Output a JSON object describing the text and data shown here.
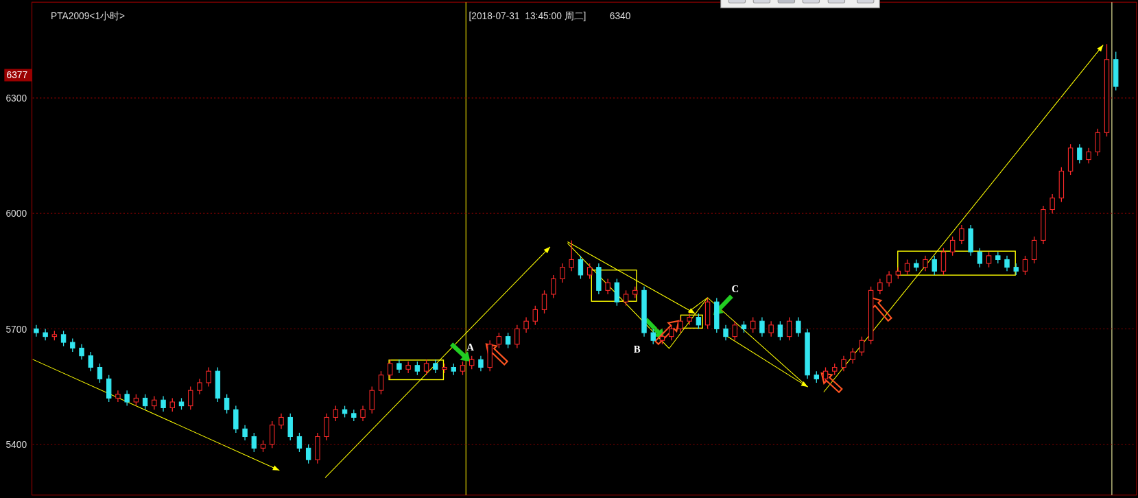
{
  "chart": {
    "title": "PTA2009<1小时>",
    "cursor_time": "[2018-07-31  13:45:00 周二]",
    "cursor_price": "6340",
    "price_tag": "6377",
    "markers": [
      {
        "label": "A"
      },
      {
        "label": "B"
      },
      {
        "label": "C"
      }
    ],
    "chart_data": {
      "type": "candlestick",
      "grid": true,
      "ylim": [
        5268,
        6549
      ],
      "yticks": [
        6300,
        6000,
        5700,
        5400
      ],
      "ohlc": [
        [
          5700,
          5710,
          5680,
          5690
        ],
        [
          5690,
          5700,
          5670,
          5680
        ],
        [
          5680,
          5695,
          5670,
          5685
        ],
        [
          5685,
          5695,
          5655,
          5665
        ],
        [
          5665,
          5675,
          5640,
          5650
        ],
        [
          5650,
          5660,
          5620,
          5630
        ],
        [
          5630,
          5640,
          5590,
          5600
        ],
        [
          5600,
          5610,
          5560,
          5570
        ],
        [
          5570,
          5580,
          5510,
          5520
        ],
        [
          5520,
          5540,
          5510,
          5530
        ],
        [
          5530,
          5540,
          5500,
          5510
        ],
        [
          5510,
          5530,
          5500,
          5520
        ],
        [
          5520,
          5530,
          5490,
          5500
        ],
        [
          5500,
          5525,
          5490,
          5515
        ],
        [
          5515,
          5525,
          5485,
          5495
        ],
        [
          5495,
          5520,
          5485,
          5510
        ],
        [
          5510,
          5520,
          5490,
          5500
        ],
        [
          5500,
          5550,
          5490,
          5540
        ],
        [
          5540,
          5570,
          5530,
          5560
        ],
        [
          5560,
          5600,
          5550,
          5590
        ],
        [
          5590,
          5600,
          5510,
          5520
        ],
        [
          5520,
          5530,
          5480,
          5490
        ],
        [
          5490,
          5500,
          5430,
          5440
        ],
        [
          5440,
          5450,
          5410,
          5420
        ],
        [
          5420,
          5430,
          5380,
          5390
        ],
        [
          5390,
          5410,
          5380,
          5400
        ],
        [
          5400,
          5460,
          5390,
          5450
        ],
        [
          5450,
          5480,
          5440,
          5470
        ],
        [
          5470,
          5480,
          5410,
          5420
        ],
        [
          5420,
          5430,
          5380,
          5390
        ],
        [
          5390,
          5400,
          5350,
          5360
        ],
        [
          5360,
          5430,
          5350,
          5420
        ],
        [
          5420,
          5480,
          5410,
          5470
        ],
        [
          5470,
          5500,
          5460,
          5490
        ],
        [
          5490,
          5500,
          5470,
          5480
        ],
        [
          5480,
          5490,
          5460,
          5470
        ],
        [
          5470,
          5500,
          5460,
          5490
        ],
        [
          5490,
          5550,
          5480,
          5540
        ],
        [
          5540,
          5590,
          5530,
          5580
        ],
        [
          5580,
          5620,
          5570,
          5610
        ],
        [
          5610,
          5620,
          5585,
          5595
        ],
        [
          5595,
          5615,
          5585,
          5605
        ],
        [
          5605,
          5615,
          5580,
          5590
        ],
        [
          5590,
          5620,
          5580,
          5610
        ],
        [
          5610,
          5620,
          5585,
          5595
        ],
        [
          5595,
          5610,
          5585,
          5600
        ],
        [
          5600,
          5610,
          5580,
          5590
        ],
        [
          5590,
          5615,
          5580,
          5605
        ],
        [
          5605,
          5630,
          5595,
          5620
        ],
        [
          5620,
          5630,
          5590,
          5600
        ],
        [
          5600,
          5670,
          5590,
          5660
        ],
        [
          5660,
          5690,
          5650,
          5680
        ],
        [
          5680,
          5690,
          5650,
          5660
        ],
        [
          5660,
          5710,
          5650,
          5700
        ],
        [
          5700,
          5730,
          5690,
          5720
        ],
        [
          5720,
          5760,
          5710,
          5750
        ],
        [
          5750,
          5800,
          5740,
          5790
        ],
        [
          5790,
          5840,
          5780,
          5830
        ],
        [
          5830,
          5870,
          5820,
          5860
        ],
        [
          5860,
          5930,
          5850,
          5880
        ],
        [
          5880,
          5890,
          5830,
          5840
        ],
        [
          5840,
          5870,
          5830,
          5860
        ],
        [
          5860,
          5870,
          5790,
          5800
        ],
        [
          5800,
          5830,
          5790,
          5820
        ],
        [
          5820,
          5830,
          5760,
          5770
        ],
        [
          5770,
          5800,
          5760,
          5790
        ],
        [
          5790,
          5810,
          5780,
          5800
        ],
        [
          5800,
          5810,
          5680,
          5690
        ],
        [
          5690,
          5700,
          5660,
          5670
        ],
        [
          5670,
          5690,
          5660,
          5680
        ],
        [
          5680,
          5710,
          5670,
          5700
        ],
        [
          5700,
          5730,
          5690,
          5720
        ],
        [
          5720,
          5740,
          5710,
          5730
        ],
        [
          5730,
          5740,
          5700,
          5710
        ],
        [
          5710,
          5780,
          5700,
          5770
        ],
        [
          5770,
          5780,
          5690,
          5700
        ],
        [
          5700,
          5710,
          5670,
          5680
        ],
        [
          5680,
          5720,
          5670,
          5710
        ],
        [
          5710,
          5720,
          5690,
          5700
        ],
        [
          5700,
          5730,
          5690,
          5720
        ],
        [
          5720,
          5730,
          5680,
          5690
        ],
        [
          5690,
          5720,
          5680,
          5710
        ],
        [
          5710,
          5720,
          5670,
          5680
        ],
        [
          5680,
          5730,
          5670,
          5720
        ],
        [
          5720,
          5730,
          5680,
          5690
        ],
        [
          5690,
          5700,
          5570,
          5580
        ],
        [
          5580,
          5590,
          5560,
          5570
        ],
        [
          5570,
          5600,
          5560,
          5590
        ],
        [
          5590,
          5610,
          5580,
          5600
        ],
        [
          5600,
          5630,
          5590,
          5620
        ],
        [
          5620,
          5650,
          5610,
          5640
        ],
        [
          5640,
          5680,
          5630,
          5670
        ],
        [
          5670,
          5810,
          5660,
          5800
        ],
        [
          5800,
          5830,
          5790,
          5820
        ],
        [
          5820,
          5850,
          5810,
          5840
        ],
        [
          5840,
          5860,
          5830,
          5850
        ],
        [
          5850,
          5880,
          5840,
          5870
        ],
        [
          5870,
          5880,
          5850,
          5860
        ],
        [
          5860,
          5890,
          5850,
          5880
        ],
        [
          5880,
          5890,
          5840,
          5850
        ],
        [
          5850,
          5910,
          5840,
          5900
        ],
        [
          5900,
          5940,
          5890,
          5930
        ],
        [
          5930,
          5970,
          5920,
          5960
        ],
        [
          5960,
          5970,
          5890,
          5900
        ],
        [
          5900,
          5910,
          5860,
          5870
        ],
        [
          5870,
          5900,
          5860,
          5890
        ],
        [
          5890,
          5900,
          5870,
          5880
        ],
        [
          5880,
          5890,
          5850,
          5860
        ],
        [
          5860,
          5870,
          5840,
          5850
        ],
        [
          5850,
          5890,
          5840,
          5880
        ],
        [
          5880,
          5940,
          5870,
          5930
        ],
        [
          5930,
          6020,
          5920,
          6010
        ],
        [
          6010,
          6050,
          6000,
          6040
        ],
        [
          6040,
          6120,
          6030,
          6110
        ],
        [
          6110,
          6180,
          6100,
          6170
        ],
        [
          6170,
          6180,
          6130,
          6140
        ],
        [
          6140,
          6170,
          6130,
          6160
        ],
        [
          6160,
          6220,
          6150,
          6210
        ],
        [
          6210,
          6440,
          6200,
          6400
        ],
        [
          6400,
          6420,
          6320,
          6330
        ]
      ]
    }
  }
}
